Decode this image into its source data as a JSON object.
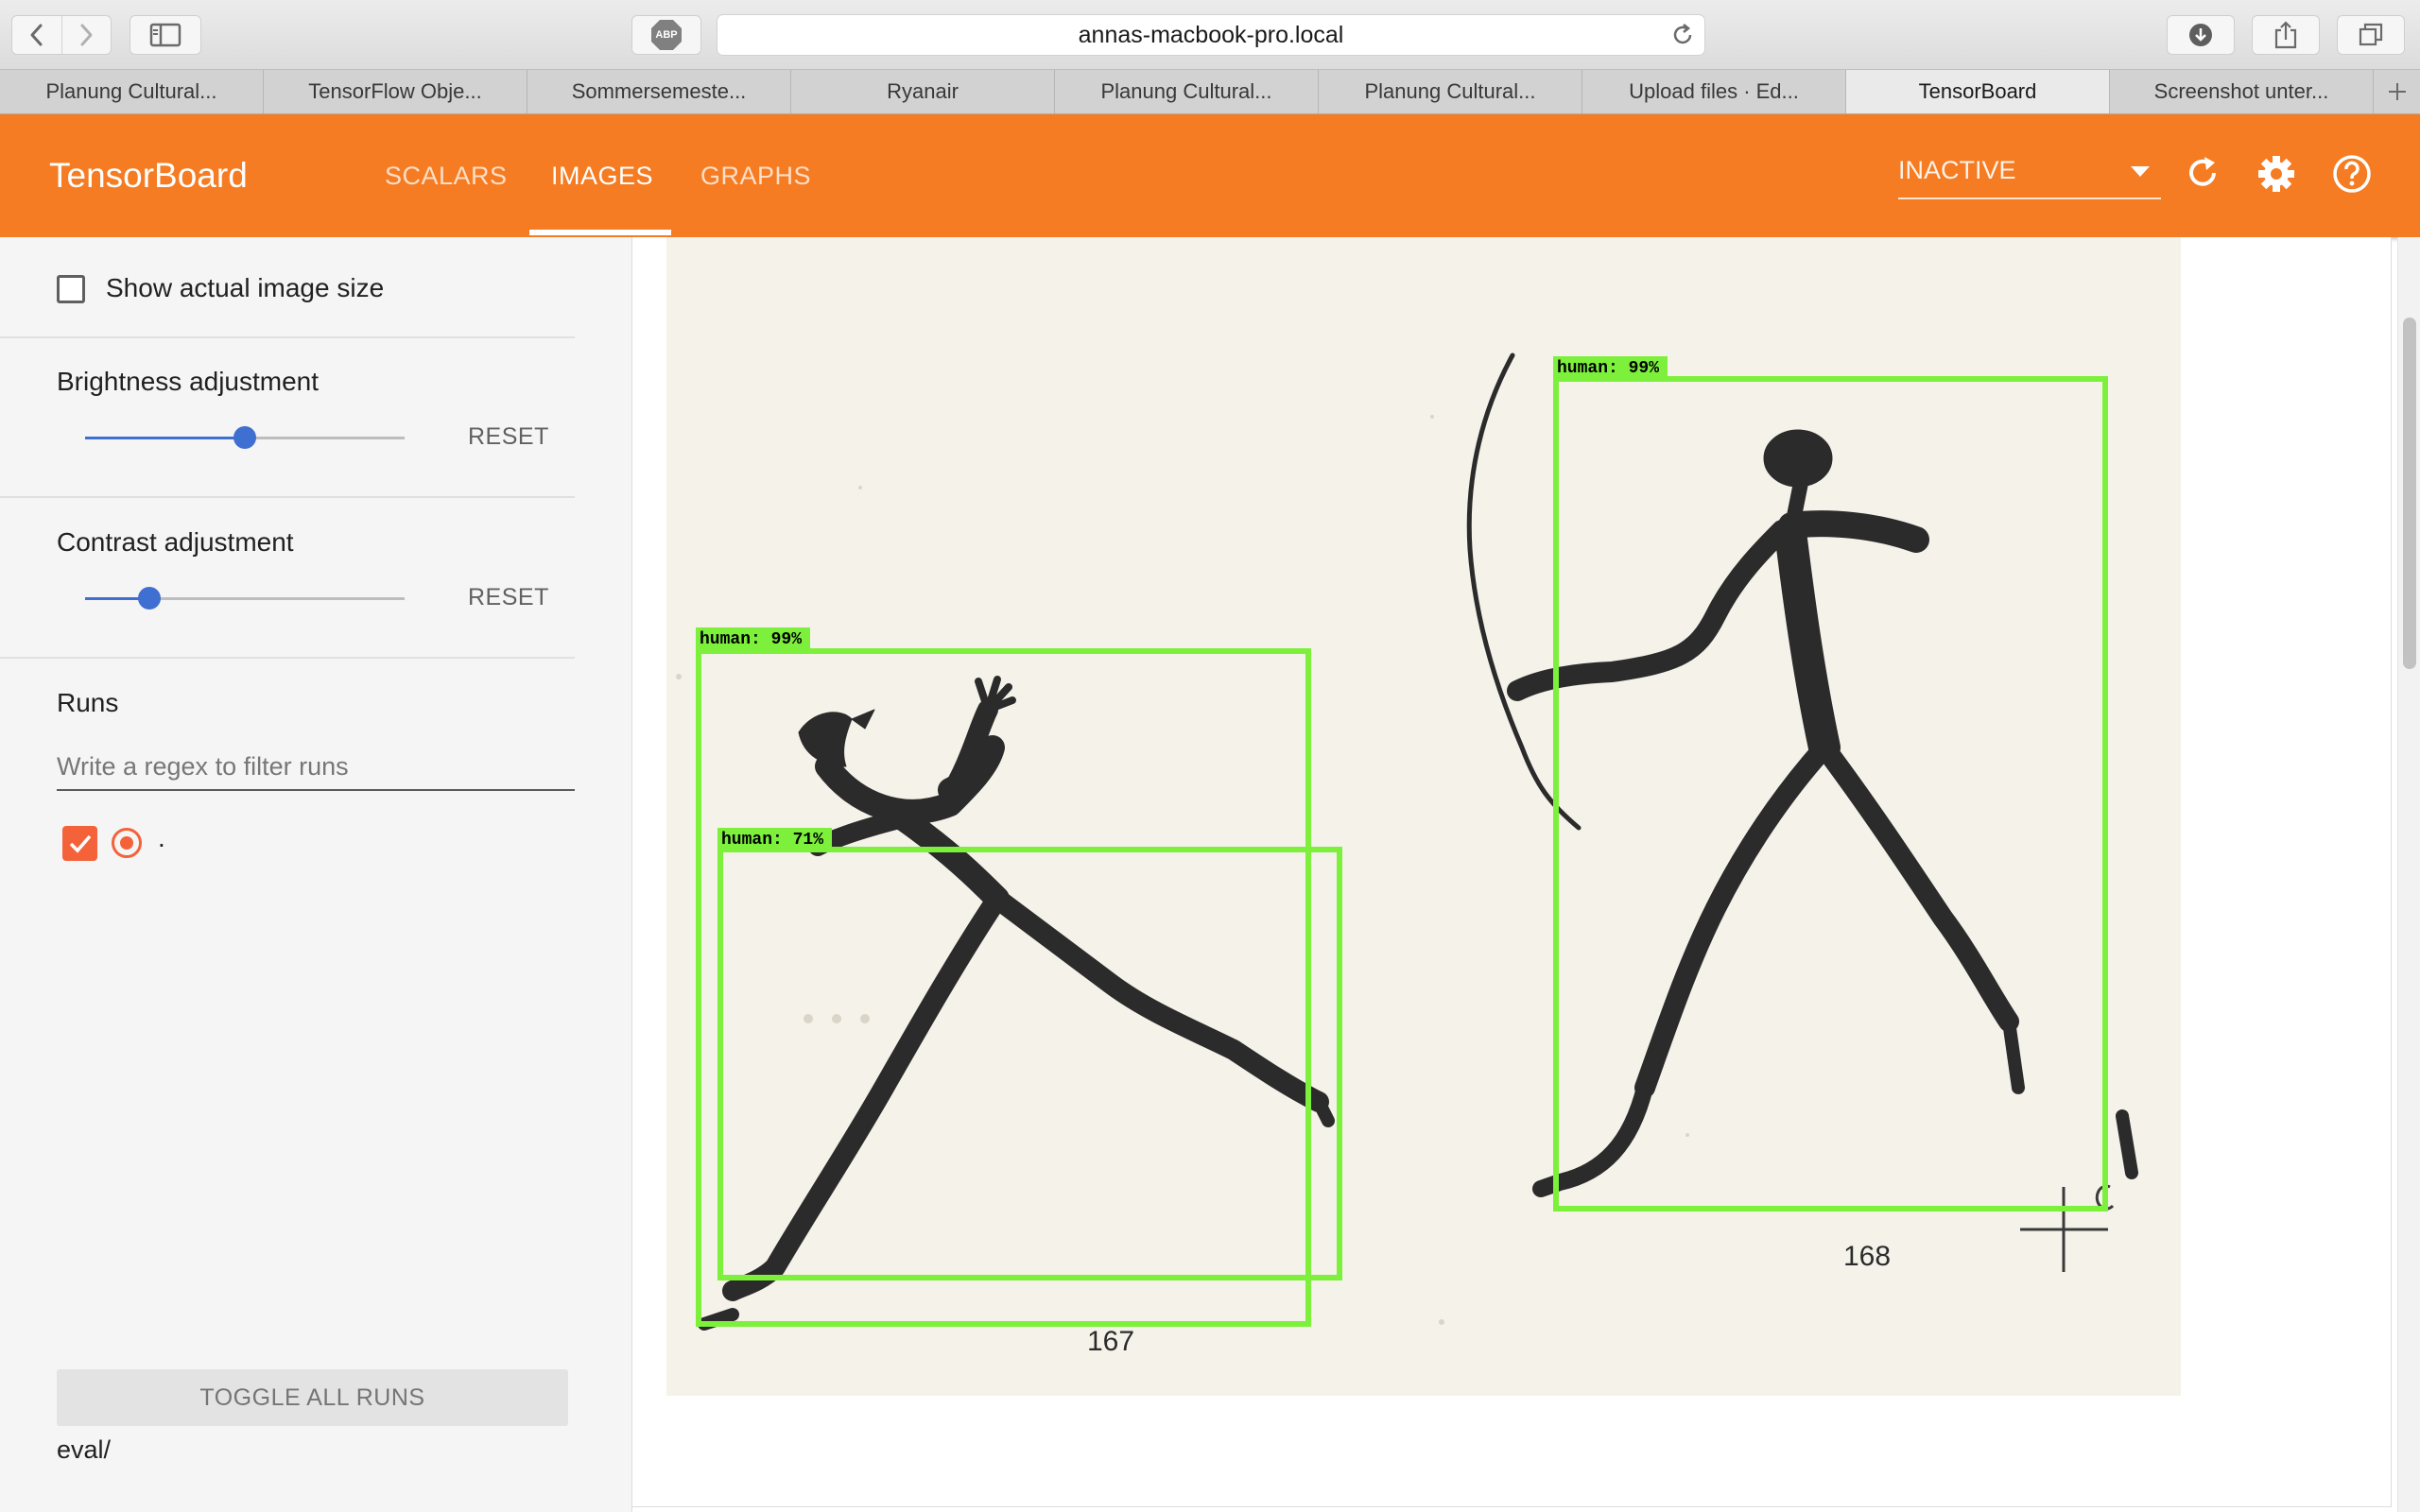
{
  "browser": {
    "url": "annas-macbook-pro.local",
    "adblock_label": "ABP",
    "tabs": [
      {
        "label": "Planung Cultural...",
        "active": false
      },
      {
        "label": "TensorFlow Obje...",
        "active": false
      },
      {
        "label": "Sommersemeste...",
        "active": false
      },
      {
        "label": "Ryanair",
        "active": false
      },
      {
        "label": "Planung Cultural...",
        "active": false
      },
      {
        "label": "Planung Cultural...",
        "active": false
      },
      {
        "label": "Upload files · Ed...",
        "active": false
      },
      {
        "label": "TensorBoard",
        "active": true
      },
      {
        "label": "Screenshot unter...",
        "active": false
      }
    ]
  },
  "header": {
    "title": "TensorBoard",
    "tabs": [
      "SCALARS",
      "IMAGES",
      "GRAPHS"
    ],
    "active_tab": "IMAGES",
    "run_state": "INACTIVE",
    "accent_color": "#f57c22"
  },
  "sidebar": {
    "show_actual_size_label": "Show actual image size",
    "show_actual_size_checked": false,
    "brightness": {
      "label": "Brightness adjustment",
      "reset_label": "RESET",
      "value": 0.5
    },
    "contrast": {
      "label": "Contrast adjustment",
      "reset_label": "RESET",
      "value": 0.2
    },
    "runs_title": "Runs",
    "filter_placeholder": "Write a regex to filter runs",
    "runs": [
      {
        "name": ".",
        "checked": true,
        "color": "#f4623a"
      }
    ],
    "toggle_all_label": "TOGGLE ALL RUNS",
    "run_path": "eval/"
  },
  "image": {
    "detections": [
      {
        "label": "human: 99%"
      },
      {
        "label": "human: 71%"
      },
      {
        "label": "human: 99%"
      }
    ],
    "figure_numbers": [
      "167",
      "168"
    ],
    "box_color": "#7df03c"
  }
}
